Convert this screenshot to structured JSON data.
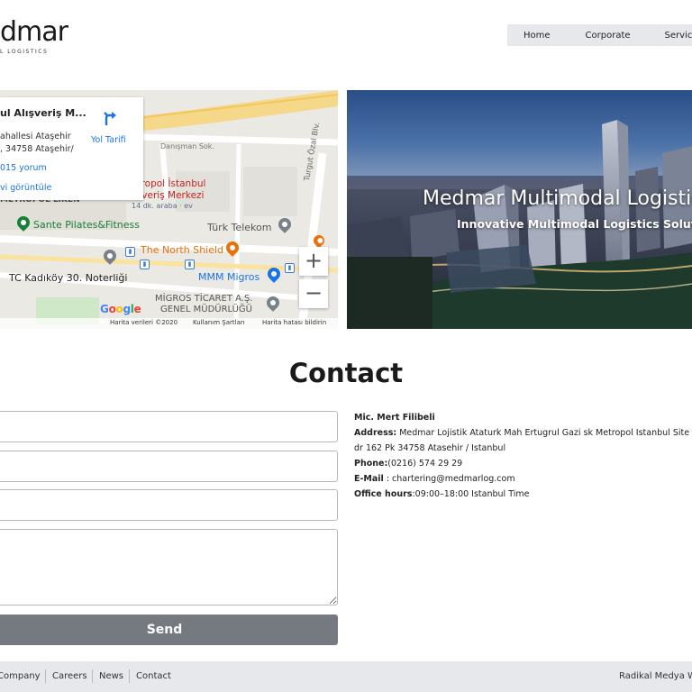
{
  "header": {
    "logo_main": "dmar",
    "logo_sub": "L  LOGISTICS",
    "nav": [
      "Home",
      "Corporate",
      "Services"
    ]
  },
  "map": {
    "info_title": "ul Alışveriş M...",
    "info_addr_1": "ahallesi Ataşehir",
    "info_addr_2": ", 34758 Ataşehir/",
    "reviews_link": "015 yorum",
    "view_link": "vi görüntüle",
    "directions_label": "Yol Tarifi",
    "labels": {
      "danisman": "Danışman Sok.",
      "metropol_1": "etropol İstanbul",
      "metropol_2": "lışveriş Merkezi",
      "metropol_3": "14 dk. araba · ev",
      "metropol_cut": "METROPOL LIKEN",
      "sante": "Sante Pilates&Fitness",
      "turk_telekom": "Türk Telekom",
      "turgut": "Turgut Özal Blv.",
      "north_shield": "The North Shield",
      "noterlik": "TC Kadıköy 30. Noterliği",
      "migros": "MMM Migros",
      "migros_ticaret_1": "MİGROS TİCARET A.Ş.",
      "migros_ticaret_2": "GENEL MÜDÜRLÜĞÜ"
    },
    "zoom_in": "+",
    "zoom_out": "−",
    "google": "Google",
    "footer_data": "Harita verileri ©2020",
    "footer_terms": "Kullanım Şartları",
    "footer_report": "Harita hatası bildirin"
  },
  "hero": {
    "title": "Medmar Multimodal Logistics",
    "subtitle": "Innovative Multimodal Logistics Solutions"
  },
  "contact": {
    "title": "Contact",
    "send_label": "Send",
    "name": "Mic. Mert Filibeli",
    "address_label": "Address:",
    "address_1": " Medmar Lojistik Ataturk Mah Ertugrul Gazi sk Metropol Istanbul Site",
    "address_2": "dr 162 Pk 34758 Atasehir / Istanbul",
    "phone_label": "Phone:",
    "phone": "(0216) 574 29 29",
    "email_label": "E-Mail",
    "email": " : chartering@medmarlog.com",
    "hours_label": "Office hours",
    "hours": ":09:00–18:00 Istanbul Time"
  },
  "footer": {
    "links": [
      "Company",
      "Careers",
      "News",
      "Contact"
    ],
    "right": "Radikal Medya W"
  },
  "colors": {
    "nav_bg": "#e7e8ec",
    "send_bg": "#757a80",
    "link_blue": "#1a73e8"
  }
}
